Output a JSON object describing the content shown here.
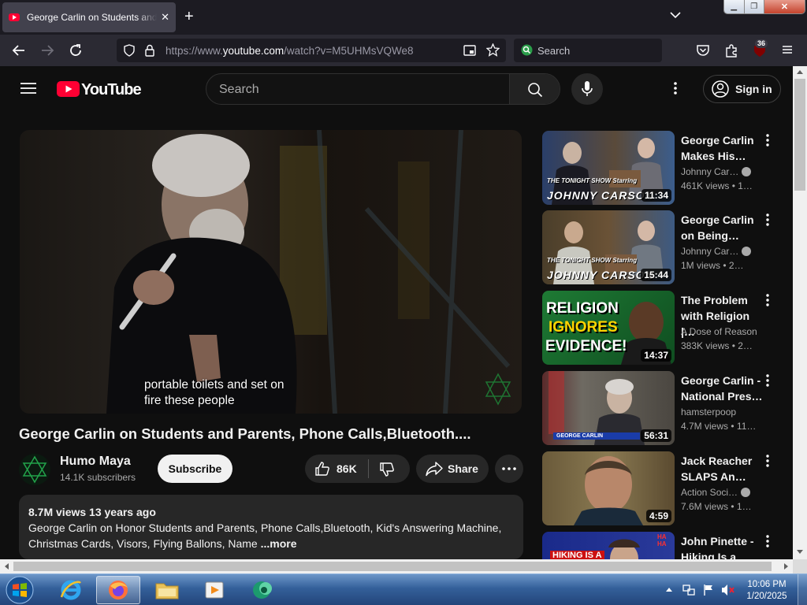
{
  "browser": {
    "tab_title": "George Carlin on Students and Parents, Phone Calls,Bluetooth....",
    "tab_close": "✕",
    "new_tab": "+",
    "url_prefix": "https://www.",
    "url_domain": "youtube.com",
    "url_path": "/watch?v=M5UHMsVQWe8",
    "search_placeholder": "Search",
    "extension_badge": "36"
  },
  "youtube": {
    "logo_text": "YouTube",
    "search_placeholder": "Search",
    "sign_in": "Sign in",
    "video": {
      "caption_line1": "portable toilets and set on",
      "caption_line2": "fire these people",
      "title": "George Carlin on Students and Parents, Phone Calls,Bluetooth....",
      "channel": "Humo Maya",
      "subscribers": "14.1K subscribers",
      "subscribe": "Subscribe",
      "likes": "86K",
      "share": "Share",
      "views_date": "8.7M views  13 years ago",
      "description": "George Carlin on Honor Students and Parents, Phone Calls,Bluetooth, Kid's Answering Machine, Christmas Cards, Visors, Flying Ballons, Name ",
      "more": "...more"
    },
    "recommendations": [
      {
        "title": "George Carlin Makes His…",
        "channel": "Johnny Car…",
        "verified": true,
        "views": "461K views",
        "age": "• 1…",
        "duration": "11:34",
        "overlay": "THE TONIGHT SHOW Starring",
        "overlay2": "JOHNNY CARSON"
      },
      {
        "title": "George Carlin on Being…",
        "channel": "Johnny Car…",
        "verified": true,
        "views": "1M views",
        "age": "• 2…",
        "duration": "15:44",
        "overlay": "THE TONIGHT SHOW Starring",
        "overlay2": "JOHNNY CARSON"
      },
      {
        "title": "The Problem with Religion |…",
        "channel": "A Dose of Reason",
        "verified": false,
        "views": "383K views",
        "age": "• 2…",
        "duration": "14:37",
        "overlay": "RELIGION",
        "overlay2": "IGNORES",
        "overlay3": "EVIDENCE!"
      },
      {
        "title": "George Carlin - National Pres…",
        "channel": "hamsterpoop",
        "verified": false,
        "views": "4.7M views",
        "age": "• 11…",
        "duration": "56:31",
        "overlay": "GEORGE CARLIN"
      },
      {
        "title": "Jack Reacher SLAPS An…",
        "channel": "Action Soci…",
        "verified": true,
        "views": "7.6M views",
        "age": "• 1…",
        "duration": "4:59"
      },
      {
        "title": "John Pinette - Hiking Is a Wa…",
        "overlay": "HIKING IS A",
        "overlay2": "HA HA"
      }
    ]
  },
  "taskbar": {
    "time": "10:06 PM",
    "date": "1/20/2025"
  }
}
